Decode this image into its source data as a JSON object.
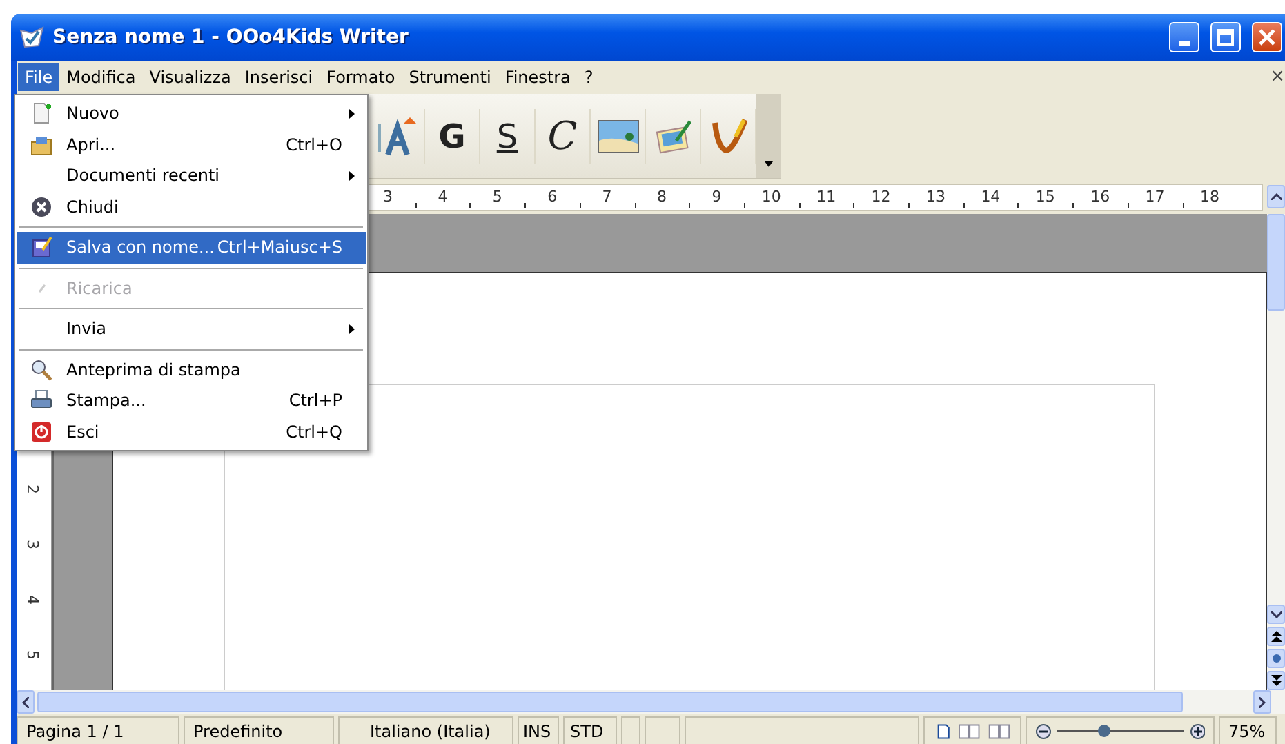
{
  "window": {
    "title": "Senza nome 1 - OOo4Kids Writer"
  },
  "menu_bar": [
    {
      "label": "File",
      "selected": true
    },
    {
      "label": "Modifica",
      "selected": false
    },
    {
      "label": "Visualizza",
      "selected": false
    },
    {
      "label": "Inserisci",
      "selected": false
    },
    {
      "label": "Formato",
      "selected": false
    },
    {
      "label": "Strumenti",
      "selected": false
    },
    {
      "label": "Finestra",
      "selected": false
    },
    {
      "label": "?",
      "selected": false
    }
  ],
  "document_close": "×",
  "file_menu": [
    {
      "kind": "new",
      "label": "Nuovo",
      "submenu": true,
      "selected": false,
      "disabled": false
    },
    {
      "kind": "open",
      "label": "Apri...",
      "shortcut": "Ctrl+O",
      "submenu": false,
      "selected": false,
      "disabled": false
    },
    {
      "kind": "plain",
      "label": "Documenti recenti",
      "submenu": true,
      "selected": false,
      "disabled": false
    },
    {
      "kind": "close",
      "label": "Chiudi",
      "submenu": false,
      "selected": false,
      "disabled": false
    },
    {
      "kind": "separator"
    },
    {
      "kind": "save",
      "label": "Salva con nome...",
      "shortcut": "Ctrl+Maiusc+S",
      "submenu": false,
      "selected": true,
      "disabled": false
    },
    {
      "kind": "separator"
    },
    {
      "kind": "reload",
      "label": "Ricarica",
      "submenu": false,
      "selected": false,
      "disabled": true
    },
    {
      "kind": "separator"
    },
    {
      "kind": "plain",
      "label": "Invia",
      "submenu": true,
      "selected": false,
      "disabled": false
    },
    {
      "kind": "separator"
    },
    {
      "kind": "preview",
      "label": "Anteprima di stampa",
      "submenu": false,
      "selected": false,
      "disabled": false
    },
    {
      "kind": "print",
      "label": "Stampa...",
      "shortcut": "Ctrl+P",
      "submenu": false,
      "selected": false,
      "disabled": false
    },
    {
      "kind": "exit",
      "label": "Esci",
      "shortcut": "Ctrl+Q",
      "submenu": false,
      "selected": false,
      "disabled": false
    }
  ],
  "toolbar": [
    {
      "kind": "fontwork"
    },
    {
      "kind": "bold",
      "label": "G"
    },
    {
      "kind": "underline",
      "label": "S"
    },
    {
      "kind": "italic",
      "label": "C"
    },
    {
      "kind": "image"
    },
    {
      "kind": "gallery"
    },
    {
      "kind": "brush"
    },
    {
      "kind": "overflow"
    }
  ],
  "ruler": {
    "horizontal": [
      "3",
      "4",
      "5",
      "6",
      "7",
      "8",
      "9",
      "10",
      "11",
      "12",
      "13",
      "14",
      "15",
      "16",
      "17",
      "18"
    ],
    "vertical": [
      "2",
      "3",
      "4",
      "5"
    ]
  },
  "status_bar": {
    "page": "Pagina 1 / 1",
    "style": "Predefinito",
    "language": "Italiano (Italia)",
    "insert_mode": "INS",
    "selection_mode": "STD",
    "zoom": {
      "level": 0.38,
      "reading": "75%"
    }
  }
}
